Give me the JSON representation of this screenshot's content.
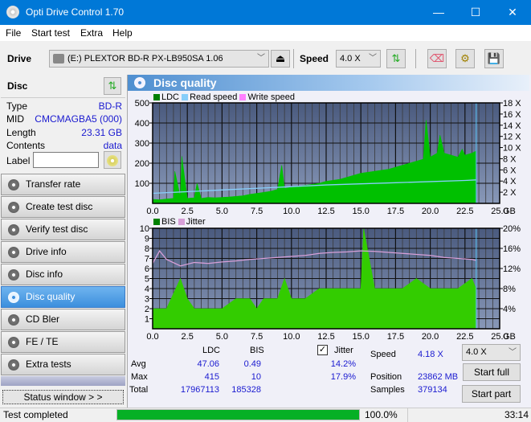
{
  "window": {
    "title": "Opti Drive Control 1.70",
    "minimize": "—",
    "maximize": "☐",
    "close": "✕"
  },
  "menu": [
    "File",
    "Start test",
    "Extra",
    "Help"
  ],
  "toolbar": {
    "drive_label": "Drive",
    "drive_value": "(E:)  PLEXTOR BD-R  PX-LB950SA 1.06",
    "speed_label": "Speed",
    "speed_value": "4.0 X",
    "eject_icon": "⏏",
    "refresh_icon": "⇅",
    "erase_icon": "⌫",
    "settings_icon": "⚙",
    "save_icon": "💾"
  },
  "disc": {
    "header": "Disc",
    "rows": [
      {
        "label": "Type",
        "value": "BD-R"
      },
      {
        "label": "MID",
        "value": "CMCMAGBA5 (000)"
      },
      {
        "label": "Length",
        "value": "23.31 GB"
      },
      {
        "label": "Contents",
        "value": "data"
      }
    ],
    "label_field_label": "Label",
    "label_value": ""
  },
  "nav": [
    {
      "label": "Transfer rate",
      "active": false
    },
    {
      "label": "Create test disc",
      "active": false
    },
    {
      "label": "Verify test disc",
      "active": false
    },
    {
      "label": "Drive info",
      "active": false
    },
    {
      "label": "Disc info",
      "active": false
    },
    {
      "label": "Disc quality",
      "active": true
    },
    {
      "label": "CD Bler",
      "active": false
    },
    {
      "label": "FE / TE",
      "active": false
    },
    {
      "label": "Extra tests",
      "active": false
    }
  ],
  "status_window_btn": "Status window > >",
  "panel_title": "Disc quality",
  "chart_data": [
    {
      "type": "area",
      "title": "LDC / Read speed",
      "legend": [
        "LDC",
        "Read speed",
        "Write speed"
      ],
      "legend_colors": [
        "#008000",
        "#87cefa",
        "#ff80ff"
      ],
      "xlabel": "GB",
      "x_ticks": [
        "0.0",
        "2.5",
        "5.0",
        "7.5",
        "10.0",
        "12.5",
        "15.0",
        "17.5",
        "20.0",
        "22.5",
        "25.0"
      ],
      "xlim": [
        0,
        25
      ],
      "y_ticks_left": [
        "500",
        "400",
        "300",
        "200",
        "100"
      ],
      "ylim_left": [
        0,
        500
      ],
      "y_ticks_right": [
        "18 X",
        "16 X",
        "14 X",
        "12 X",
        "10 X",
        "8 X",
        "6 X",
        "4 X",
        "2 X"
      ],
      "ylim_right": [
        0,
        18
      ],
      "series": [
        {
          "name": "LDC",
          "color": "#00c000",
          "x": [
            0,
            0.5,
            1,
            1.5,
            1.6,
            2,
            2.1,
            2.5,
            3,
            3.2,
            3.5,
            4,
            4.5,
            5,
            5.5,
            6,
            6.5,
            7,
            7.5,
            8,
            8.5,
            9,
            9.3,
            9.5,
            10,
            10.5,
            11,
            11.5,
            12,
            12.5,
            13,
            13.5,
            14,
            14.5,
            15,
            15.5,
            16,
            16.5,
            17,
            17.5,
            18,
            18.5,
            19,
            19.5,
            19.7,
            20,
            20.5,
            20.7,
            21,
            21.5,
            22,
            22.3,
            22.5,
            23,
            23.3
          ],
          "y": [
            20,
            18,
            22,
            25,
            160,
            30,
            235,
            25,
            28,
            100,
            25,
            30,
            28,
            30,
            32,
            35,
            38,
            45,
            50,
            55,
            60,
            70,
            190,
            75,
            80,
            85,
            90,
            95,
            100,
            110,
            115,
            120,
            130,
            140,
            150,
            155,
            160,
            165,
            170,
            180,
            190,
            200,
            210,
            220,
            415,
            230,
            250,
            340,
            250,
            240,
            230,
            270,
            240,
            250,
            260
          ]
        },
        {
          "name": "Read speed",
          "color": "#87cefa",
          "x": [
            0,
            2.5,
            5,
            7.5,
            10,
            12.5,
            15,
            17.5,
            20,
            22.5,
            23.3
          ],
          "y": [
            1.8,
            2.1,
            2.4,
            2.7,
            3.0,
            3.3,
            3.5,
            3.7,
            3.9,
            4.1,
            4.2
          ]
        }
      ]
    },
    {
      "type": "area",
      "title": "BIS / Jitter",
      "legend": [
        "BIS",
        "Jitter"
      ],
      "legend_colors": [
        "#008000",
        "#d8a0d8"
      ],
      "xlabel": "GB",
      "x_ticks": [
        "0.0",
        "2.5",
        "5.0",
        "7.5",
        "10.0",
        "12.5",
        "15.0",
        "17.5",
        "20.0",
        "22.5",
        "25.0"
      ],
      "xlim": [
        0,
        25
      ],
      "y_ticks_left": [
        "10",
        "9",
        "8",
        "7",
        "6",
        "5",
        "4",
        "3",
        "2",
        "1"
      ],
      "ylim_left": [
        0,
        10
      ],
      "y_ticks_right": [
        "20%",
        "16%",
        "12%",
        "8%",
        "4%"
      ],
      "ylim_right": [
        0,
        20
      ],
      "series": [
        {
          "name": "BIS",
          "color": "#33cc00",
          "x": [
            0,
            1,
            2,
            2.5,
            3,
            4,
            5,
            6,
            7,
            7.5,
            8,
            9,
            9.5,
            10,
            11,
            12,
            13,
            14,
            15,
            15.2,
            16,
            17,
            18,
            19,
            20,
            21,
            22,
            23,
            23.3
          ],
          "y": [
            2,
            2,
            5,
            3,
            2,
            2,
            2,
            3,
            3,
            2,
            3,
            3,
            5,
            3,
            3,
            4,
            4,
            4,
            4,
            10,
            4,
            4,
            4,
            5,
            4,
            4,
            4,
            5,
            4
          ]
        },
        {
          "name": "Jitter",
          "color": "#d8a0d8",
          "x": [
            0,
            0.5,
            1,
            2,
            3,
            4,
            5,
            6,
            7,
            8,
            9,
            10,
            11,
            12,
            13,
            14,
            15,
            16,
            17,
            18,
            19,
            20,
            21,
            22,
            23,
            23.3
          ],
          "y": [
            13.0,
            15.5,
            13.8,
            12.5,
            13.2,
            13.0,
            13.3,
            13.5,
            13.8,
            14.0,
            14.2,
            14.4,
            14.6,
            15.0,
            15.2,
            15.3,
            15.5,
            15.4,
            15.2,
            15.0,
            14.8,
            14.6,
            14.2,
            14.0,
            13.8,
            13.6
          ]
        }
      ]
    }
  ],
  "stats": {
    "col_ldc": "LDC",
    "col_bis": "BIS",
    "jitter_label": "Jitter",
    "jitter_checked": true,
    "rows": [
      {
        "label": "Avg",
        "ldc": "47.06",
        "bis": "0.49",
        "jitter": "14.2%"
      },
      {
        "label": "Max",
        "ldc": "415",
        "bis": "10",
        "jitter": "17.9%"
      },
      {
        "label": "Total",
        "ldc": "17967113",
        "bis": "185328",
        "jitter": ""
      }
    ],
    "speed_label": "Speed",
    "speed_value": "4.18 X",
    "position_label": "Position",
    "position_value": "23862 MB",
    "samples_label": "Samples",
    "samples_value": "379134",
    "speed_select": "4.0 X",
    "start_full": "Start full",
    "start_part": "Start part"
  },
  "statusbar": {
    "text": "Test completed",
    "progress": 100.0,
    "progress_text": "100.0%",
    "time": "33:14"
  }
}
